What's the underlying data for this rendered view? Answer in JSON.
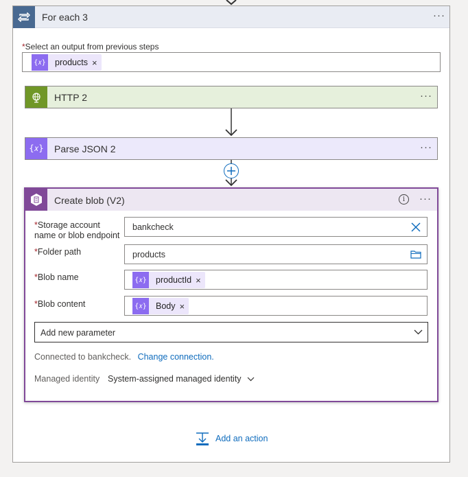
{
  "foreach": {
    "title": "For each 3",
    "select_label": "Select an output from previous steps",
    "select_token": "products"
  },
  "http": {
    "title": "HTTP 2"
  },
  "parse": {
    "title": "Parse JSON 2"
  },
  "blob": {
    "title": "Create blob (V2)",
    "fields": {
      "storage_label": "Storage account name or blob endpoint",
      "storage_value": "bankcheck",
      "folder_label": "Folder path",
      "folder_value": "products",
      "blobname_label": "Blob name",
      "blobname_token": "productId",
      "content_label": "Blob content",
      "content_token": "Body"
    },
    "add_param": "Add new parameter",
    "connected_text": "Connected to bankcheck.",
    "change_connection": "Change connection.",
    "identity_label": "Managed identity",
    "identity_value": "System-assigned managed identity"
  },
  "add_action": "Add an action",
  "colors": {
    "foreach_header": "#e9ecf3",
    "http_header": "#e6f0dc",
    "http_icon": "#709727",
    "parse_header": "#ece9fb",
    "parse_icon": "#8c6cf0",
    "blob_header": "#ede7f2",
    "blob_border": "#804998",
    "link": "#0f6cbd"
  }
}
